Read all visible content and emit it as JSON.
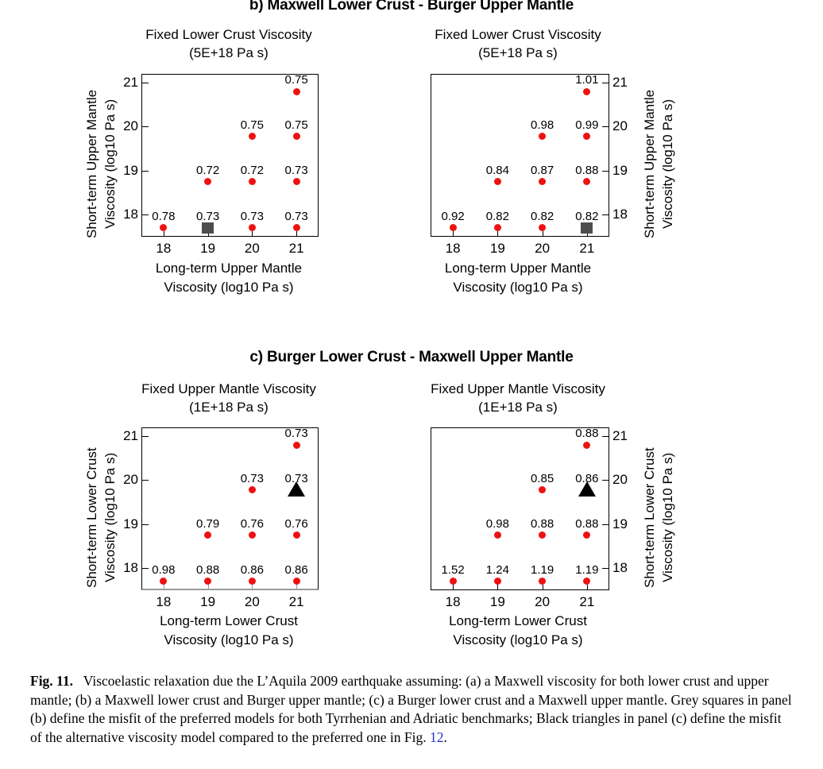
{
  "figure": {
    "headings": {
      "b": "b) Maxwell Lower Crust - Burger Upper Mantle",
      "c": "c) Burger Lower Crust - Maxwell Upper Mantle"
    },
    "caption": {
      "label": "Fig. 11.",
      "text": "Viscoelastic relaxation due the L’Aquila 2009 earthquake assuming: (a) a Maxwell viscosity for both lower crust and upper mantle; (b) a Maxwell lower crust and Burger upper mantle; (c) a Burger lower crust and a Maxwell upper mantle. Grey squares in panel (b) define the misfit of the preferred models for both Tyrrhenian and Adriatic benchmarks; Black triangles in panel (c) define the misfit of the alternative viscosity model compared to the preferred one in Fig. ",
      "ref": "12",
      "tail": "."
    }
  },
  "colors": {
    "marker_red": "#ee1111",
    "square_grey": "#4d4d4d",
    "triangle_black": "#000000",
    "axis_black": "#000000",
    "baseline_grey": "#9a9a9a",
    "link_blue": "#2233cc"
  },
  "chart_data": [
    {
      "id": "b-left",
      "type": "scatter",
      "panel": "b",
      "position": "left",
      "title": "Fixed Lower Crust Viscosity",
      "subtitle": "(5E+18 Pa s)",
      "xlabel": "Long-term Upper Mantle\nViscosity (log10 Pa s)",
      "xlabel_line1": "Long-term Upper Mantle",
      "xlabel_line2": "Viscosity (log10 Pa s)",
      "ylabel_line1": "Short-term Upper Mantle",
      "ylabel_line2": "Viscosity (log10 Pa s)",
      "ylabel_side": "left",
      "xticks": [
        18,
        19,
        20,
        21
      ],
      "yticks": [
        18,
        19,
        20,
        21
      ],
      "xlim": [
        17.5,
        21.5
      ],
      "ylim": [
        17.5,
        21.2
      ],
      "grid": false,
      "points": [
        {
          "x": 18,
          "y": 17.7,
          "label": "0.78",
          "marker": "circle"
        },
        {
          "x": 19,
          "y": 17.7,
          "label": "0.73",
          "marker": "square"
        },
        {
          "x": 20,
          "y": 17.7,
          "label": "0.73",
          "marker": "circle"
        },
        {
          "x": 21,
          "y": 17.7,
          "label": "0.73",
          "marker": "circle"
        },
        {
          "x": 19,
          "y": 18.75,
          "label": "0.72",
          "marker": "circle"
        },
        {
          "x": 20,
          "y": 18.75,
          "label": "0.72",
          "marker": "circle"
        },
        {
          "x": 21,
          "y": 18.75,
          "label": "0.73",
          "marker": "circle"
        },
        {
          "x": 20,
          "y": 19.78,
          "label": "0.75",
          "marker": "circle"
        },
        {
          "x": 21,
          "y": 19.78,
          "label": "0.75",
          "marker": "circle"
        },
        {
          "x": 21,
          "y": 20.8,
          "label": "0.75",
          "marker": "circle"
        }
      ]
    },
    {
      "id": "b-right",
      "type": "scatter",
      "panel": "b",
      "position": "right",
      "title": "Fixed Lower Crust Viscosity",
      "subtitle": "(5E+18 Pa s)",
      "xlabel_line1": "Long-term Upper Mantle",
      "xlabel_line2": "Viscosity (log10 Pa s)",
      "ylabel_line1": "Short-term Upper Mantle",
      "ylabel_line2": "Viscosity (log10 Pa s)",
      "ylabel_side": "right",
      "xticks": [
        18,
        19,
        20,
        21
      ],
      "yticks": [
        18,
        19,
        20,
        21
      ],
      "xlim": [
        17.5,
        21.5
      ],
      "ylim": [
        17.5,
        21.2
      ],
      "grid": false,
      "points": [
        {
          "x": 18,
          "y": 17.7,
          "label": "0.92",
          "marker": "circle"
        },
        {
          "x": 19,
          "y": 17.7,
          "label": "0.82",
          "marker": "circle"
        },
        {
          "x": 20,
          "y": 17.7,
          "label": "0.82",
          "marker": "circle"
        },
        {
          "x": 21,
          "y": 17.7,
          "label": "0.82",
          "marker": "square"
        },
        {
          "x": 19,
          "y": 18.75,
          "label": "0.84",
          "marker": "circle"
        },
        {
          "x": 20,
          "y": 18.75,
          "label": "0.87",
          "marker": "circle"
        },
        {
          "x": 21,
          "y": 18.75,
          "label": "0.88",
          "marker": "circle"
        },
        {
          "x": 20,
          "y": 19.78,
          "label": "0.98",
          "marker": "circle"
        },
        {
          "x": 21,
          "y": 19.78,
          "label": "0.99",
          "marker": "circle"
        },
        {
          "x": 21,
          "y": 20.8,
          "label": "1.01",
          "marker": "circle"
        }
      ]
    },
    {
      "id": "c-left",
      "type": "scatter",
      "panel": "c",
      "position": "left",
      "title": "Fixed Upper Mantle Viscosity",
      "subtitle": "(1E+18 Pa s)",
      "xlabel_line1": "Long-term Lower Crust",
      "xlabel_line2": "Viscosity (log10 Pa s)",
      "ylabel_line1": "Short-term Lower Crust",
      "ylabel_line2": "Viscosity (log10 Pa s)",
      "ylabel_side": "left",
      "xticks": [
        18,
        19,
        20,
        21
      ],
      "yticks": [
        18,
        19,
        20,
        21
      ],
      "xlim": [
        17.5,
        21.5
      ],
      "ylim": [
        17.5,
        21.2
      ],
      "grid": false,
      "points": [
        {
          "x": 18,
          "y": 17.7,
          "label": "0.98",
          "marker": "circle",
          "stem": true
        },
        {
          "x": 19,
          "y": 17.7,
          "label": "0.88",
          "marker": "circle",
          "stem": true
        },
        {
          "x": 20,
          "y": 17.7,
          "label": "0.86",
          "marker": "circle",
          "stem": true
        },
        {
          "x": 21,
          "y": 17.7,
          "label": "0.86",
          "marker": "circle",
          "stem": true
        },
        {
          "x": 19,
          "y": 18.75,
          "label": "0.79",
          "marker": "circle"
        },
        {
          "x": 20,
          "y": 18.75,
          "label": "0.76",
          "marker": "circle"
        },
        {
          "x": 21,
          "y": 18.75,
          "label": "0.76",
          "marker": "circle"
        },
        {
          "x": 20,
          "y": 19.78,
          "label": "0.73",
          "marker": "circle"
        },
        {
          "x": 21,
          "y": 19.78,
          "label": "0.73",
          "marker": "triangle"
        },
        {
          "x": 21,
          "y": 20.8,
          "label": "0.73",
          "marker": "circle"
        }
      ]
    },
    {
      "id": "c-right",
      "type": "scatter",
      "panel": "c",
      "position": "right",
      "title": "Fixed Upper Mantle Viscosity",
      "subtitle": "(1E+18 Pa s)",
      "xlabel_line1": "Long-term Lower Crust",
      "xlabel_line2": "Viscosity (log10 Pa s)",
      "ylabel_line1": "Short-term Lower Crust",
      "ylabel_line2": "Viscosity (log10 Pa s)",
      "ylabel_side": "right",
      "xticks": [
        18,
        19,
        20,
        21
      ],
      "yticks": [
        18,
        19,
        20,
        21
      ],
      "xlim": [
        17.5,
        21.5
      ],
      "ylim": [
        17.5,
        21.2
      ],
      "grid": false,
      "points": [
        {
          "x": 18,
          "y": 17.7,
          "label": "1.52",
          "marker": "circle"
        },
        {
          "x": 19,
          "y": 17.7,
          "label": "1.24",
          "marker": "circle"
        },
        {
          "x": 20,
          "y": 17.7,
          "label": "1.19",
          "marker": "circle"
        },
        {
          "x": 21,
          "y": 17.7,
          "label": "1.19",
          "marker": "circle"
        },
        {
          "x": 19,
          "y": 18.75,
          "label": "0.98",
          "marker": "circle"
        },
        {
          "x": 20,
          "y": 18.75,
          "label": "0.88",
          "marker": "circle"
        },
        {
          "x": 21,
          "y": 18.75,
          "label": "0.88",
          "marker": "circle"
        },
        {
          "x": 20,
          "y": 19.78,
          "label": "0.85",
          "marker": "circle"
        },
        {
          "x": 21,
          "y": 19.78,
          "label": "0.86",
          "marker": "triangle"
        },
        {
          "x": 21,
          "y": 20.8,
          "label": "0.88",
          "marker": "circle"
        }
      ]
    }
  ]
}
